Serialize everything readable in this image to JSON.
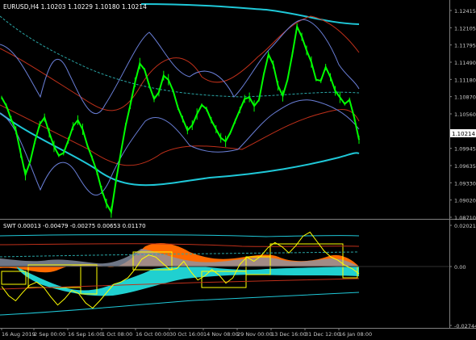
{
  "main_chart": {
    "symbol_header": "EURUSD,H4  1.10203 1.10229 1.10180 1.10214",
    "current_price": "1.10214",
    "y_ticks": [
      "1.12415",
      "1.12105",
      "1.11795",
      "1.11490",
      "1.11180",
      "1.10870",
      "1.10560",
      "1.10250",
      "1.09945",
      "1.09635",
      "1.09330",
      "1.09020",
      "1.08710"
    ]
  },
  "indicator": {
    "header": "SWT 0.00013 -0.00479 -0.00275 0.00653 0.01170",
    "y_ticks": [
      "0.02021",
      "0.00",
      "-0.02744"
    ]
  },
  "x_ticks": [
    "16 Aug 2019",
    "2 Sep 00:00",
    "16 Sep 16:00",
    "1 Oct 08:00",
    "16 Oct 00:00",
    "30 Oct 16:00",
    "14 Nov 08:00",
    "29 Nov 00:00",
    "13 Dec 16:00",
    "31 Dec 12:00",
    "16 Jan 08:00"
  ],
  "colors": {
    "background": "#000000",
    "price_line": "#00ff00",
    "band_cyan": "#1fc8d8",
    "band_red": "#c0301a",
    "band_blue": "#6a7fd8",
    "dashed_mid": "#2aa6a6",
    "axis_text": "#c8c8c8",
    "osc_yellow": "#ffff00",
    "osc_orange": "#ff6a00",
    "osc_cyan": "#20d0d0",
    "osc_gray": "#8a94a8"
  },
  "chart_data": [
    {
      "type": "line",
      "ylim": [
        1.0871,
        1.1272
      ],
      "y_labels": [
        "1.12415",
        "1.12105",
        "1.11795",
        "1.11490",
        "1.11180",
        "1.10870",
        "1.10560",
        "1.10250",
        "1.09945",
        "1.09635",
        "1.09330",
        "1.09020",
        "1.08710"
      ],
      "series": [
        {
          "values": [
            1.1105,
            1.1088,
            1.1062,
            1.104,
            1.0995,
            1.0952,
            1.0978,
            1.1018,
            1.1052,
            1.1065,
            1.1035,
            1.1008,
            1.099,
            1.0995,
            1.102,
            1.1048,
            1.106,
            1.1042,
            1.101,
            1.0985,
            1.0958,
            1.0922,
            1.0895,
            1.0878,
            1.094,
            1.0995,
            1.1048,
            1.109,
            1.1135,
            1.1172,
            1.116,
            1.1128,
            1.1102,
            1.1115,
            1.1148,
            1.114,
            1.1118,
            1.1085,
            1.1062,
            1.104,
            1.105,
            1.1072,
            1.109,
            1.1082,
            1.106,
            1.1042,
            1.1025,
            1.1018,
            1.1035,
            1.1058,
            1.108,
            1.1102,
            1.1105,
            1.1088,
            1.11,
            1.115,
            1.119,
            1.117,
            1.1128,
            1.1108,
            1.114,
            1.119,
            1.1245,
            1.1225,
            1.1198,
            1.1175,
            1.114,
            1.1138,
            1.1165,
            1.1145,
            1.1118,
            1.1105,
            1.1092,
            1.11,
            1.1065,
            1.1021
          ]
        }
      ]
    },
    {
      "type": "line",
      "ylim": [
        -0.0282,
        0.0214
      ],
      "y_labels": [
        "0.02021",
        "0.00",
        "-0.02744"
      ],
      "series": [
        {
          "values": [
            -0.009,
            -0.0135,
            -0.016,
            -0.012,
            -0.0085,
            -0.007,
            -0.0095,
            -0.014,
            -0.018,
            -0.015,
            -0.011,
            -0.0125,
            -0.017,
            -0.0195,
            -0.016,
            -0.012,
            -0.008,
            -0.007,
            -0.005,
            -0.001,
            0.004,
            0.006,
            0.005,
            0.002,
            -0.001,
            -0.0005,
            0.003,
            -0.002,
            -0.006,
            -0.004,
            -0.001,
            -0.0035,
            -0.0075,
            -0.005,
            0.0015,
            0.005,
            0.003,
            0.0055,
            0.0095,
            0.012,
            0.01,
            0.007,
            0.0105,
            0.015,
            0.017,
            0.0125,
            0.008,
            0.005,
            0.0035,
            0.001,
            -0.0005,
            -0.003
          ]
        }
      ]
    }
  ]
}
